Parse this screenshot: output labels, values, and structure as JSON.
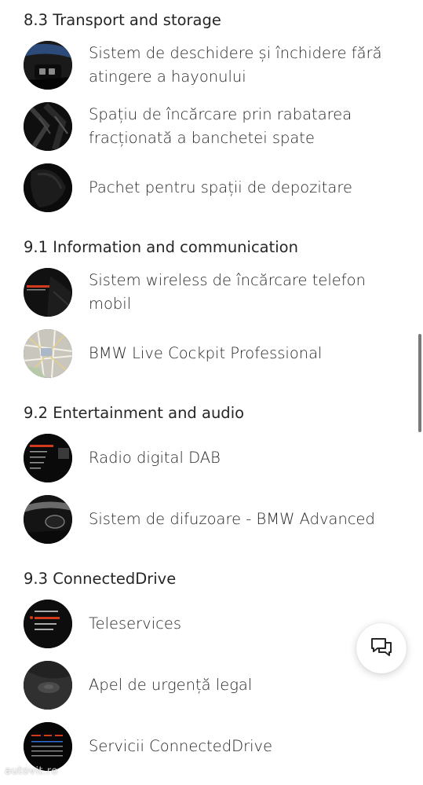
{
  "sections": [
    {
      "title": "8.3 Transport and storage",
      "items": [
        {
          "label": "Sistem de deschidere și închidere fără atingere a hayonului",
          "thumb": "tailgate-photo"
        },
        {
          "label": "Spațiu de încărcare prin rabatarea fracționată a banchetei spate",
          "thumb": "rear-seat-photo"
        },
        {
          "label": "Pachet pentru spații de depozitare",
          "thumb": "storage-photo"
        }
      ]
    },
    {
      "title": "9.1 Information and communication",
      "items": [
        {
          "label": "Sistem wireless de încărcare telefon mobil",
          "thumb": "wireless-charging-photo"
        },
        {
          "label": "BMW Live Cockpit Professional",
          "thumb": "navigation-map-photo"
        }
      ]
    },
    {
      "title": "9.2 Entertainment and audio",
      "items": [
        {
          "label": "Radio digital DAB",
          "thumb": "radio-menu-photo"
        },
        {
          "label": "Sistem de difuzoare - BMW Advanced",
          "thumb": "speaker-photo"
        }
      ]
    },
    {
      "title": "9.3 ConnectedDrive",
      "items": [
        {
          "label": "Teleservices",
          "thumb": "teleservices-menu-photo"
        },
        {
          "label": "Apel de urgență legal",
          "thumb": "sos-button-photo"
        },
        {
          "label": "Servicii ConnectedDrive",
          "thumb": "connecteddrive-screen-photo"
        }
      ]
    }
  ],
  "chat_button": {
    "icon": "chat-bubbles-icon"
  },
  "watermark": "autovit.ro",
  "colors": {
    "text": "#262626",
    "background": "#ffffff",
    "thumb_dark": "#121212",
    "accent_red": "#d23a1c",
    "accent_blue": "#2f6fd1"
  }
}
